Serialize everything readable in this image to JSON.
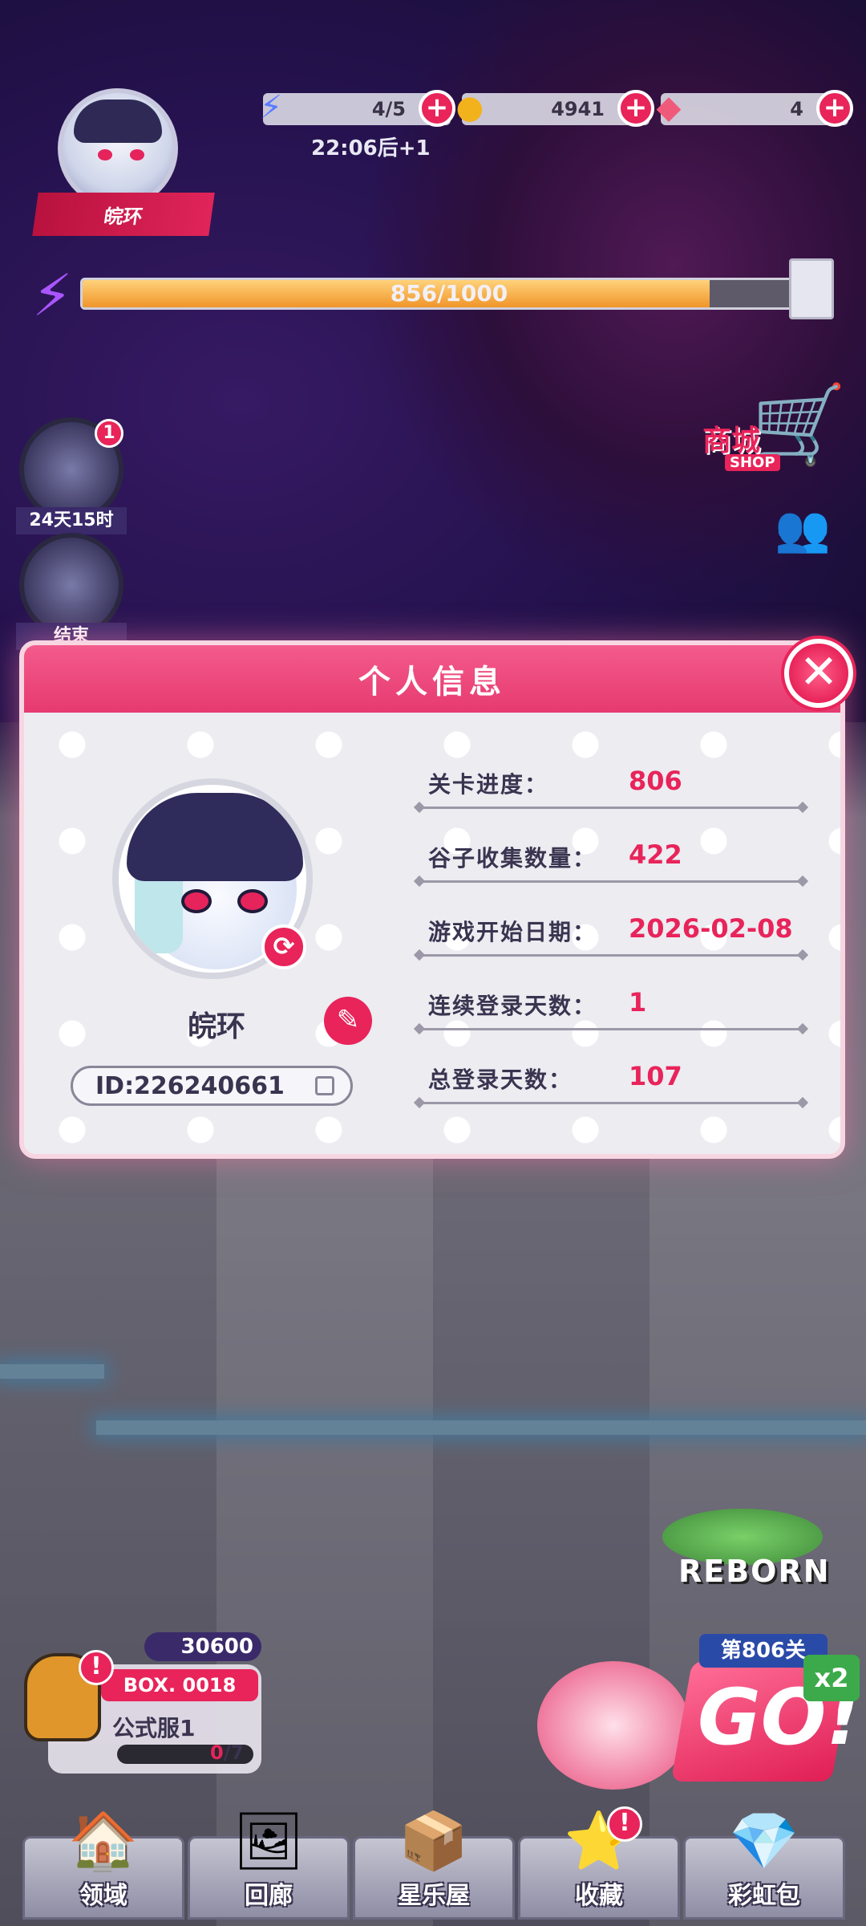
{
  "hud": {
    "energy": "4/5",
    "coins": "4941",
    "gems": "4",
    "energy_timer": "22:06后+1",
    "player_name": "皖环",
    "xp": "856/1000",
    "xp_fraction": 0.856
  },
  "side_left": {
    "event1_badge": "1",
    "event1_label": "24天15时",
    "event2_label": "结束"
  },
  "shop": {
    "title": "商城",
    "subtitle": "SHOP"
  },
  "modal": {
    "title": "个人信息",
    "close_icon": "close-icon",
    "name": "皖环",
    "id": "ID:226240661",
    "rows": [
      {
        "key": "关卡进度：",
        "value": "806"
      },
      {
        "key": "谷子收集数量：",
        "value": "422"
      },
      {
        "key": "游戏开始日期：",
        "value": "2026-02-08"
      },
      {
        "key": "连续登录天数：",
        "value": "1"
      },
      {
        "key": "总登录天数：",
        "value": "107"
      }
    ]
  },
  "reborn": {
    "label": "REBORN"
  },
  "box": {
    "points": "30600",
    "tag": "BOX. 0018",
    "name": "公式服1",
    "progress_current": "0",
    "progress_total": "/7"
  },
  "go": {
    "level": "第806关",
    "label": "GO!",
    "multiplier": "x2"
  },
  "nav": [
    {
      "label": "领域",
      "icon": "domain-icon"
    },
    {
      "label": "回廊",
      "icon": "gallery-icon"
    },
    {
      "label": "星乐屋",
      "icon": "star-house-icon"
    },
    {
      "label": "收藏",
      "icon": "star-collection-icon"
    },
    {
      "label": "彩虹包",
      "icon": "rainbow-pack-icon"
    }
  ],
  "colors": {
    "accent": "#e8245a",
    "text_dark": "#3a3450"
  }
}
